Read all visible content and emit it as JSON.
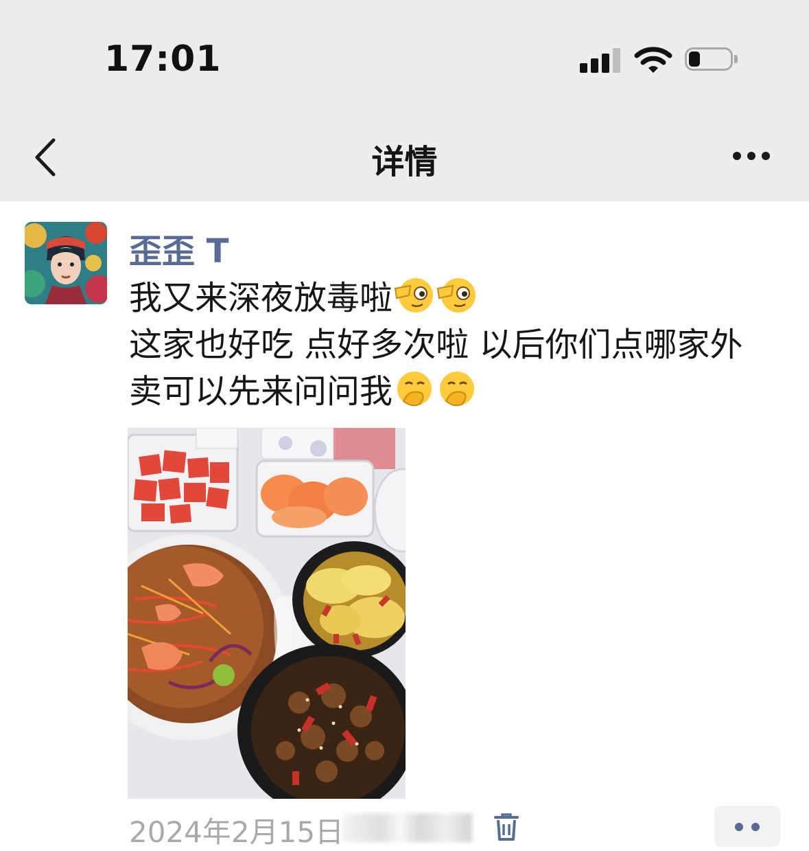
{
  "status_bar": {
    "time": "17:01",
    "signal_icon": "cellular-signal-icon",
    "wifi_icon": "wifi-icon",
    "battery_icon": "battery-icon",
    "battery_level": 0.2
  },
  "nav": {
    "back_icon": "chevron-left-icon",
    "title": "详情",
    "more_icon": "more-horizontal-icon"
  },
  "post": {
    "username": "歪歪 T",
    "text_line1": "我又来深夜放毒啦",
    "text_line2": "这家也好吃 点好多次啦 以后你们点哪家外",
    "text_line3": "卖可以先来问问我",
    "line1_emojis": [
      "face-with-monocle-emoji",
      "face-with-monocle-emoji"
    ],
    "line3_emojis": [
      "face-with-hand-over-mouth-emoji",
      "face-with-hand-over-mouth-emoji"
    ],
    "photo_alt": "food-photo",
    "date": "2024年2月15日",
    "delete_icon": "trash-icon",
    "comment_icon": "more-dots-icon"
  },
  "colors": {
    "header_bg": "#ededed",
    "username": "#576b95",
    "date": "#a9a9a9",
    "emoji_face": "#ffcb3d"
  }
}
